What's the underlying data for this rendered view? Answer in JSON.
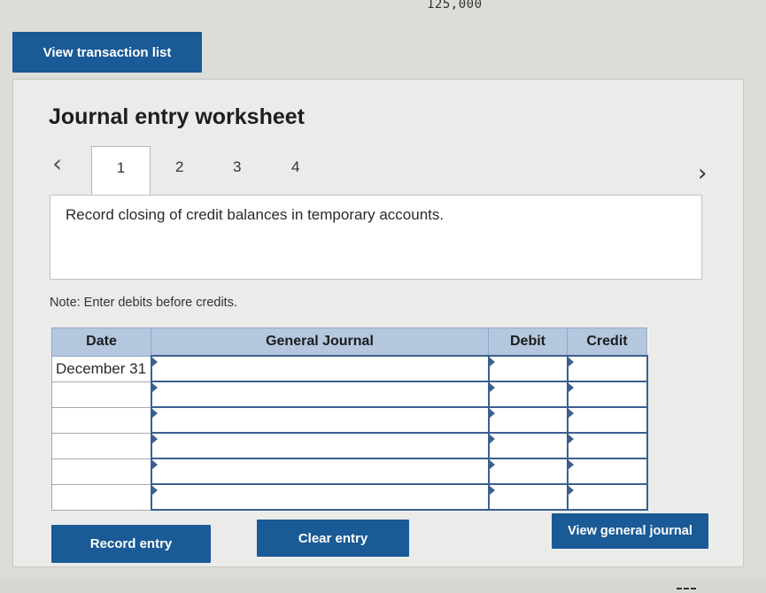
{
  "header": {
    "top_value": "125,000"
  },
  "buttons": {
    "view_transaction_list": "View transaction list",
    "record_entry": "Record entry",
    "clear_entry": "Clear entry",
    "view_general_journal": "View general journal"
  },
  "worksheet": {
    "title": "Journal entry worksheet",
    "prev_icon": "chevron-left-icon",
    "next_icon": "chevron-right-icon",
    "tabs": [
      {
        "label": "1",
        "active": true
      },
      {
        "label": "2",
        "active": false
      },
      {
        "label": "3",
        "active": false
      },
      {
        "label": "4",
        "active": false
      }
    ],
    "instruction": "Record closing of credit balances in temporary accounts.",
    "note": "Note: Enter debits before credits."
  },
  "table": {
    "columns": [
      "Date",
      "General Journal",
      "Debit",
      "Credit"
    ],
    "rows": [
      {
        "date": "December 31",
        "account": "",
        "debit": "",
        "credit": ""
      },
      {
        "date": "",
        "account": "",
        "debit": "",
        "credit": ""
      },
      {
        "date": "",
        "account": "",
        "debit": "",
        "credit": ""
      },
      {
        "date": "",
        "account": "",
        "debit": "",
        "credit": ""
      },
      {
        "date": "",
        "account": "",
        "debit": "",
        "credit": ""
      },
      {
        "date": "",
        "account": "",
        "debit": "",
        "credit": ""
      }
    ]
  }
}
